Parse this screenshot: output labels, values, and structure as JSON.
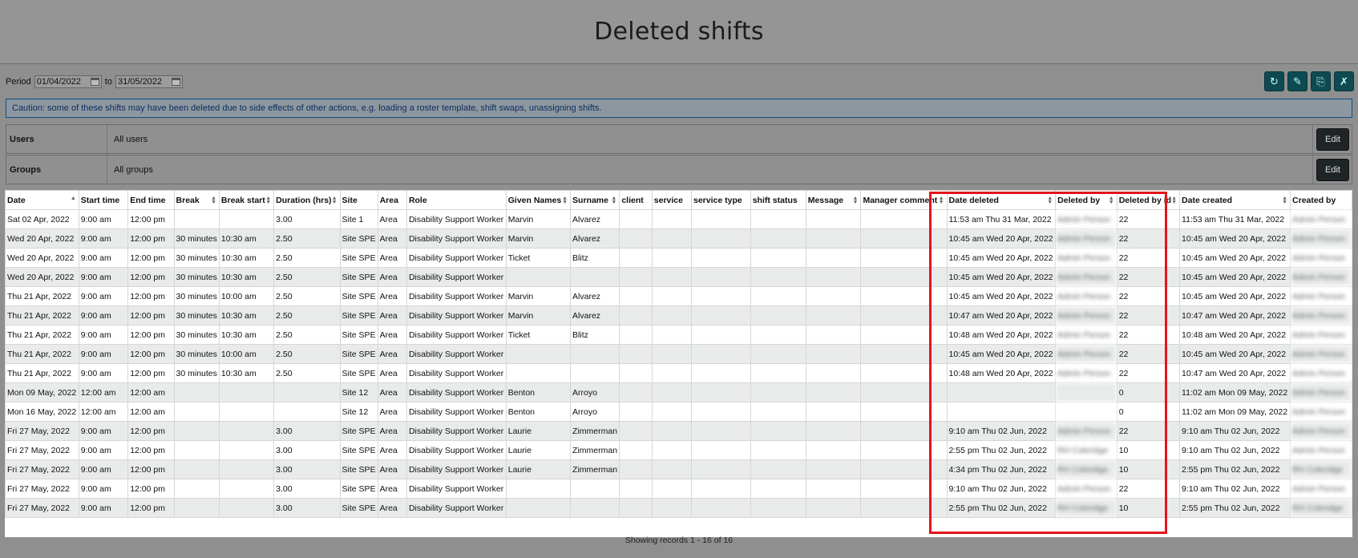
{
  "page": {
    "title": "Deleted shifts"
  },
  "period": {
    "label": "Period",
    "from": "01/04/2022",
    "to_label": "to",
    "to": "31/05/2022"
  },
  "toolbar": {
    "icons": [
      "refresh-icon",
      "edit-icon",
      "pdf-icon",
      "excel-icon"
    ]
  },
  "caution": "Caution: some of these shifts may have been deleted due to side effects of other actions, e.g. loading a roster template, shift swaps, unassigning shifts.",
  "filters": {
    "users": {
      "label": "Users",
      "value": "All users",
      "button": "Edit"
    },
    "groups": {
      "label": "Groups",
      "value": "All groups",
      "button": "Edit"
    }
  },
  "table": {
    "columns": [
      "Date",
      "Start time",
      "End time",
      "Break",
      "Break start",
      "Duration (hrs)",
      "Site",
      "Area",
      "Role",
      "Given Names",
      "Surname",
      "client",
      "service",
      "service type",
      "shift status",
      "Message",
      "Manager comment",
      "Date deleted",
      "Deleted by",
      "Deleted by id",
      "Date created",
      "Created by"
    ],
    "rows": [
      [
        "Sat 02 Apr, 2022",
        "9:00 am",
        "12:00 pm",
        "",
        "",
        "3.00",
        "Site 1",
        "Area",
        "Disability Support Worker",
        "Marvin",
        "Alvarez",
        "",
        "",
        "",
        "",
        "",
        "",
        "11:53 am Thu 31 Mar, 2022",
        "Admin Person",
        "22",
        "11:53 am Thu 31 Mar, 2022",
        "Admin Person"
      ],
      [
        "Wed 20 Apr, 2022",
        "9:00 am",
        "12:00 pm",
        "30 minutes",
        "10:30 am",
        "2.50",
        "Site SPE",
        "Area",
        "Disability Support Worker",
        "Marvin",
        "Alvarez",
        "",
        "",
        "",
        "",
        "",
        "",
        "10:45 am Wed 20 Apr, 2022",
        "Admin Person",
        "22",
        "10:45 am Wed 20 Apr, 2022",
        "Admin Person"
      ],
      [
        "Wed 20 Apr, 2022",
        "9:00 am",
        "12:00 pm",
        "30 minutes",
        "10:30 am",
        "2.50",
        "Site SPE",
        "Area",
        "Disability Support Worker",
        "Ticket",
        "Blitz",
        "",
        "",
        "",
        "",
        "",
        "",
        "10:45 am Wed 20 Apr, 2022",
        "Admin Person",
        "22",
        "10:45 am Wed 20 Apr, 2022",
        "Admin Person"
      ],
      [
        "Wed 20 Apr, 2022",
        "9:00 am",
        "12:00 pm",
        "30 minutes",
        "10:30 am",
        "2.50",
        "Site SPE",
        "Area",
        "Disability Support Worker",
        "",
        "",
        "",
        "",
        "",
        "",
        "",
        "",
        "10:45 am Wed 20 Apr, 2022",
        "Admin Person",
        "22",
        "10:45 am Wed 20 Apr, 2022",
        "Admin Person"
      ],
      [
        "Thu 21 Apr, 2022",
        "9:00 am",
        "12:00 pm",
        "30 minutes",
        "10:00 am",
        "2.50",
        "Site SPE",
        "Area",
        "Disability Support Worker",
        "Marvin",
        "Alvarez",
        "",
        "",
        "",
        "",
        "",
        "",
        "10:45 am Wed 20 Apr, 2022",
        "Admin Person",
        "22",
        "10:45 am Wed 20 Apr, 2022",
        "Admin Person"
      ],
      [
        "Thu 21 Apr, 2022",
        "9:00 am",
        "12:00 pm",
        "30 minutes",
        "10:30 am",
        "2.50",
        "Site SPE",
        "Area",
        "Disability Support Worker",
        "Marvin",
        "Alvarez",
        "",
        "",
        "",
        "",
        "",
        "",
        "10:47 am Wed 20 Apr, 2022",
        "Admin Person",
        "22",
        "10:47 am Wed 20 Apr, 2022",
        "Admin Person"
      ],
      [
        "Thu 21 Apr, 2022",
        "9:00 am",
        "12:00 pm",
        "30 minutes",
        "10:30 am",
        "2.50",
        "Site SPE",
        "Area",
        "Disability Support Worker",
        "Ticket",
        "Blitz",
        "",
        "",
        "",
        "",
        "",
        "",
        "10:48 am Wed 20 Apr, 2022",
        "Admin Person",
        "22",
        "10:48 am Wed 20 Apr, 2022",
        "Admin Person"
      ],
      [
        "Thu 21 Apr, 2022",
        "9:00 am",
        "12:00 pm",
        "30 minutes",
        "10:00 am",
        "2.50",
        "Site SPE",
        "Area",
        "Disability Support Worker",
        "",
        "",
        "",
        "",
        "",
        "",
        "",
        "",
        "10:45 am Wed 20 Apr, 2022",
        "Admin Person",
        "22",
        "10:45 am Wed 20 Apr, 2022",
        "Admin Person"
      ],
      [
        "Thu 21 Apr, 2022",
        "9:00 am",
        "12:00 pm",
        "30 minutes",
        "10:30 am",
        "2.50",
        "Site SPE",
        "Area",
        "Disability Support Worker",
        "",
        "",
        "",
        "",
        "",
        "",
        "",
        "",
        "10:48 am Wed 20 Apr, 2022",
        "Admin Person",
        "22",
        "10:47 am Wed 20 Apr, 2022",
        "Admin Person"
      ],
      [
        "Mon 09 May, 2022",
        "12:00 am",
        "12:00 am",
        "",
        "",
        "",
        "Site 12",
        "Area",
        "Disability Support Worker",
        "Benton",
        "Arroyo",
        "",
        "",
        "",
        "",
        "",
        "",
        "",
        "",
        "0",
        "11:02 am Mon 09 May, 2022",
        "Admin Person"
      ],
      [
        "Mon 16 May, 2022",
        "12:00 am",
        "12:00 am",
        "",
        "",
        "",
        "Site 12",
        "Area",
        "Disability Support Worker",
        "Benton",
        "Arroyo",
        "",
        "",
        "",
        "",
        "",
        "",
        "",
        "",
        "0",
        "11:02 am Mon 09 May, 2022",
        "Admin Person"
      ],
      [
        "Fri 27 May, 2022",
        "9:00 am",
        "12:00 pm",
        "",
        "",
        "3.00",
        "Site SPE",
        "Area",
        "Disability Support Worker",
        "Laurie",
        "Zimmerman",
        "",
        "",
        "",
        "",
        "",
        "",
        "9:10 am Thu 02 Jun, 2022",
        "Admin Person",
        "22",
        "9:10 am Thu 02 Jun, 2022",
        "Admin Person"
      ],
      [
        "Fri 27 May, 2022",
        "9:00 am",
        "12:00 pm",
        "",
        "",
        "3.00",
        "Site SPE",
        "Area",
        "Disability Support Worker",
        "Laurie",
        "Zimmerman",
        "",
        "",
        "",
        "",
        "",
        "",
        "2:55 pm Thu 02 Jun, 2022",
        "RH Coleridge",
        "10",
        "9:10 am Thu 02 Jun, 2022",
        "Admin Person"
      ],
      [
        "Fri 27 May, 2022",
        "9:00 am",
        "12:00 pm",
        "",
        "",
        "3.00",
        "Site SPE",
        "Area",
        "Disability Support Worker",
        "Laurie",
        "Zimmerman",
        "",
        "",
        "",
        "",
        "",
        "",
        "4:34 pm Thu 02 Jun, 2022",
        "RH Coleridge",
        "10",
        "2:55 pm Thu 02 Jun, 2022",
        "RH Coleridge"
      ],
      [
        "Fri 27 May, 2022",
        "9:00 am",
        "12:00 pm",
        "",
        "",
        "3.00",
        "Site SPE",
        "Area",
        "Disability Support Worker",
        "",
        "",
        "",
        "",
        "",
        "",
        "",
        "",
        "9:10 am Thu 02 Jun, 2022",
        "Admin Person",
        "22",
        "9:10 am Thu 02 Jun, 2022",
        "Admin Person"
      ],
      [
        "Fri 27 May, 2022",
        "9:00 am",
        "12:00 pm",
        "",
        "",
        "3.00",
        "Site SPE",
        "Area",
        "Disability Support Worker",
        "",
        "",
        "",
        "",
        "",
        "",
        "",
        "",
        "2:55 pm Thu 02 Jun, 2022",
        "RH Coleridge",
        "10",
        "2:55 pm Thu 02 Jun, 2022",
        "RH Coleridge"
      ]
    ]
  },
  "footer": "Showing records 1 - 16 of 16"
}
